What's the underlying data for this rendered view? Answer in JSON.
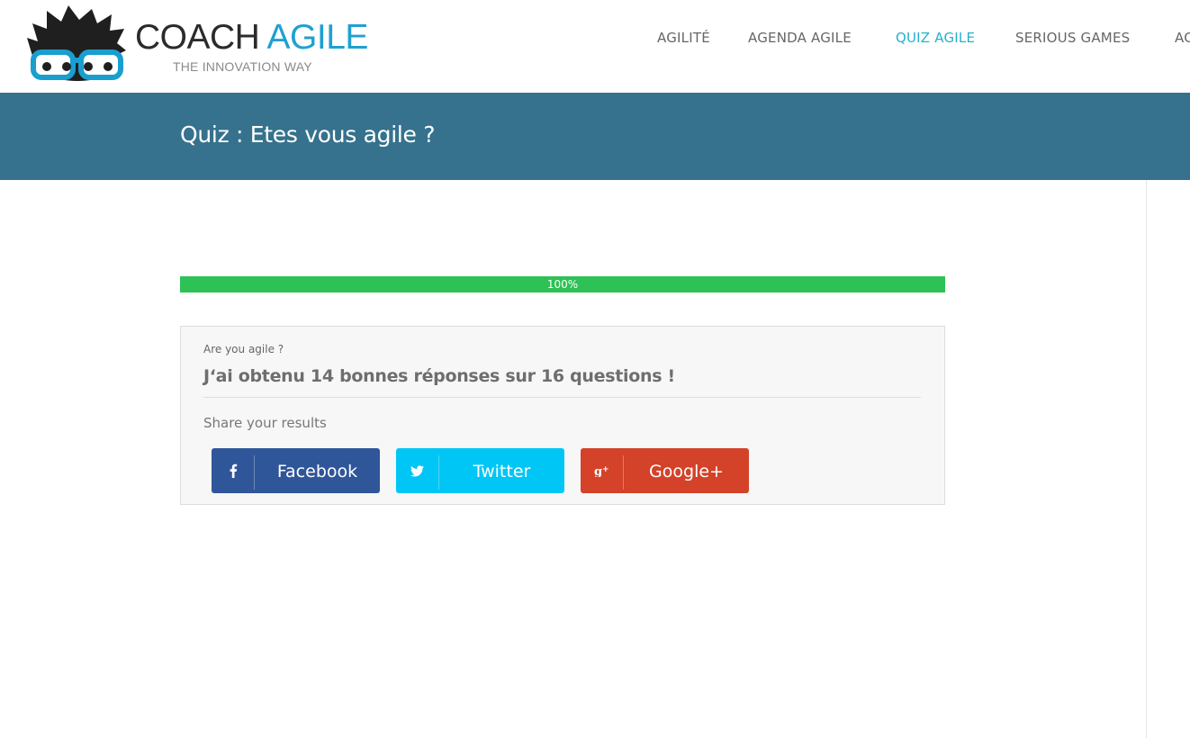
{
  "brand": {
    "name_part1": "COACH",
    "name_part2": "AGILE",
    "tagline": "THE INNOVATION WAY",
    "dark_color": "#2b2b2b",
    "accent_color": "#1fa0d2"
  },
  "nav": {
    "items": [
      {
        "label": "AGILITÉ"
      },
      {
        "label": "AGENDA AGILE"
      },
      {
        "label": "QUIZ AGILE",
        "active": true
      },
      {
        "label": "SERIOUS GAMES"
      },
      {
        "label": "AC"
      }
    ],
    "active_color": "#26b0cc"
  },
  "page": {
    "title": "Quiz : Etes vous agile ?",
    "band_color": "#36728d"
  },
  "progress": {
    "value": 1.0,
    "label": "100%",
    "color": "#2ec156"
  },
  "result": {
    "quiz_name": "Are you agile ?",
    "score_text": "J‘ai obtenu 14 bonnes réponses sur 16 questions !",
    "share_label": "Share your results"
  },
  "share_buttons": [
    {
      "label": "Facebook",
      "icon": "facebook-icon",
      "color": "#30569a"
    },
    {
      "label": "Twitter",
      "icon": "twitter-icon",
      "color": "#00c6f6"
    },
    {
      "label": "Google+",
      "icon": "google-plus-icon",
      "color": "#d34229"
    }
  ]
}
